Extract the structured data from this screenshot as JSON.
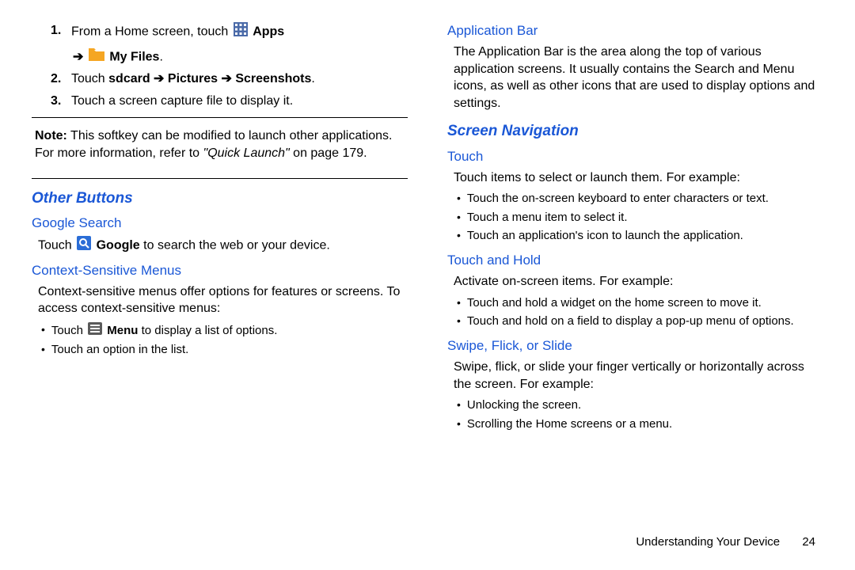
{
  "left": {
    "steps": {
      "s1_num": "1.",
      "s1_pre": "From a Home screen, touch ",
      "s1_apps": " Apps",
      "s1_arrow": "➔",
      "s1_myfiles": " My Files",
      "s1_period": ".",
      "s2_num": "2.",
      "s2_pre": "Touch ",
      "s2_bold": "sdcard ➔ Pictures ➔ Screenshots",
      "s2_period": ".",
      "s3_num": "3.",
      "s3_text": "Touch a screen capture file to display it."
    },
    "note": {
      "label": "Note:",
      "text1": " This softkey can be modified to launch other applications. For more information, refer to ",
      "italic": "\"Quick Launch\"",
      "text2": " on page 179."
    },
    "other_buttons": "Other Buttons",
    "google": {
      "title": "Google Search",
      "pre": "Touch ",
      "bold": " Google",
      "post": " to search the web or your device."
    },
    "context": {
      "title": "Context-Sensitive Menus",
      "para": "Context-sensitive menus offer options for features or screens. To access context-sensitive menus:",
      "b1_pre": "Touch ",
      "b1_bold": " Menu",
      "b1_post": " to display a list of options.",
      "b2": "Touch an option in the list."
    }
  },
  "right": {
    "appbar": {
      "title": "Application Bar",
      "para": "The Application Bar is the area along the top of various application screens. It usually contains the Search and Menu icons, as well as other icons that are used to display options and settings."
    },
    "screen_nav": "Screen Navigation",
    "touch": {
      "title": "Touch",
      "para": "Touch items to select or launch them. For example:",
      "b1": "Touch the on-screen keyboard to enter characters or text.",
      "b2": "Touch a menu item to select it.",
      "b3": "Touch an application's icon to launch the application."
    },
    "hold": {
      "title": "Touch and Hold",
      "para": "Activate on-screen items. For example:",
      "b1": "Touch and hold a widget on the home screen to move it.",
      "b2": "Touch and hold on a field to display a pop-up menu of options."
    },
    "swipe": {
      "title": "Swipe, Flick, or Slide",
      "para": "Swipe, flick, or slide your finger vertically or horizontally across the screen. For example:",
      "b1": "Unlocking the screen.",
      "b2": "Scrolling the Home screens or a menu."
    }
  },
  "footer": {
    "title": "Understanding Your Device",
    "page": "24"
  }
}
